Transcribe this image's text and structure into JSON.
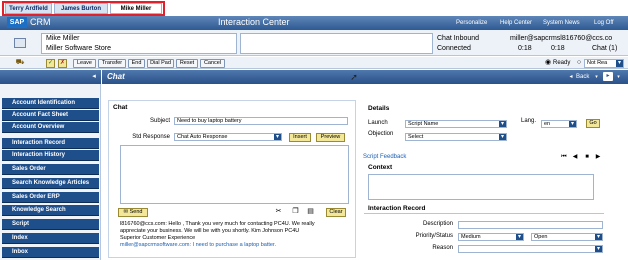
{
  "tabs": [
    {
      "label": "Terry Ardfield",
      "active": false
    },
    {
      "label": "James Burton",
      "active": false
    },
    {
      "label": "Mike Miller",
      "active": true
    }
  ],
  "header": {
    "brand": "SAP",
    "product": "CRM",
    "title": "Interaction Center",
    "links": [
      "Personalize",
      "Help Center",
      "System News",
      "Log Off"
    ]
  },
  "customer": {
    "name": "Mike Miller",
    "company": "Miller Software Store",
    "channel": "Chat Inbound",
    "status": "Connected",
    "address": "miller@sapcrmsl816760@ccs.co",
    "time1": "0:18",
    "time2": "0:18",
    "queue": "Chat (1)"
  },
  "toolbar": {
    "buttons": [
      "Leave",
      "Transfer",
      "End",
      "Dial Pad",
      "Reset",
      "Cancel"
    ],
    "ready_label": "Ready",
    "not_ready_label": "Not Rea"
  },
  "sidebar": {
    "items": [
      "Account Identification",
      "Account Fact Sheet",
      "Account Overview",
      "Interaction Record",
      "Interaction History",
      "Sales Order",
      "Search Knowledge Articles",
      "Sales Order ERP",
      "Knowledge Search",
      "Script",
      "Index",
      "Inbox"
    ]
  },
  "chat_view": {
    "title": "Chat",
    "back_label": "Back"
  },
  "chat": {
    "section_title": "Chat",
    "subject_label": "Subject",
    "subject_value": "Need to buy laptop battery",
    "std_response_label": "Std Response",
    "std_response_value": "Chat Auto Response",
    "insert_label": "Insert",
    "preview_label": "Preview",
    "send_label": "Send",
    "clear_label": "Clear",
    "transcript_line1": "l816760@ccs.com: Hello , Thank you very much for contacting PC4U. We really",
    "transcript_line2": "appreciate your business. We will be with you shortly. Kim Johnson PC4U",
    "transcript_line3": "Superior Customer Experience",
    "transcript_line4_name": "miller@sapcrmsoftware.com:",
    "transcript_line4_text": " I need to purchase a laptop batter."
  },
  "details": {
    "section_title": "Details",
    "launch_label": "Launch",
    "launch_value": "Script Name",
    "lang_label": "Lang.",
    "lang_value": "en",
    "go_label": "Go",
    "objection_label": "Objection",
    "objection_value": "Select",
    "script_feedback": "Script Feedback",
    "context_title": "Context"
  },
  "interaction_record": {
    "section_title": "Interaction Record",
    "description_label": "Description",
    "priority_label": "Priority/Status",
    "priority_value": "Medium",
    "status_value": "Open",
    "reason_label": "Reason"
  }
}
